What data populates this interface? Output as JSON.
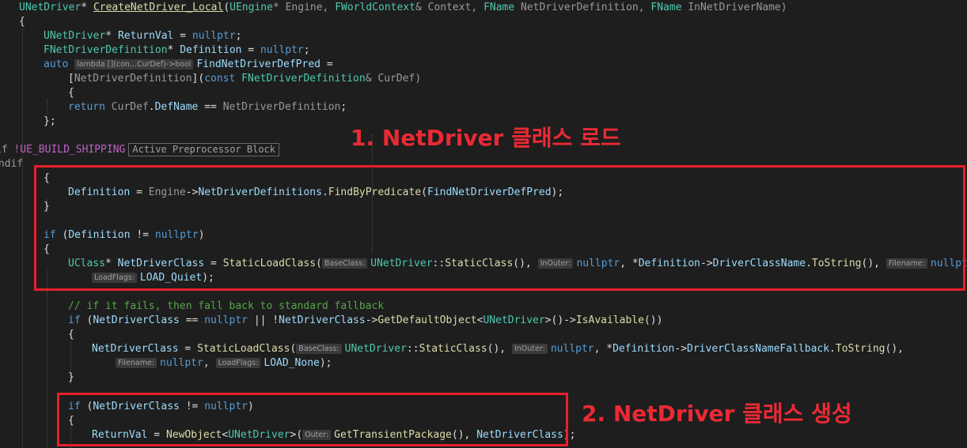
{
  "code": {
    "signature": {
      "ret_type": "UNetDriver",
      "star": "*",
      "name": "CreateNetDriver_Local",
      "open": "(",
      "p1_type": "UEngine",
      "p1_rest": "* Engine, ",
      "p2_type": "FWorldContext",
      "p2_rest": "& Context, ",
      "p3_type": "FName",
      "p3_rest": " NetDriverDefinition, ",
      "p4_type": "FName",
      "p4_rest": " InNetDriverName)"
    },
    "line_open_brace": "{",
    "decl_return": {
      "type": "UNetDriver",
      "star": "* ",
      "var": "ReturnVal",
      "eq": " = ",
      "val": "nullptr",
      "end": ";"
    },
    "decl_definition": {
      "type": "FNetDriverDefinition",
      "star": "* ",
      "var": "Definition",
      "eq": " = ",
      "val": "nullptr",
      "end": ";"
    },
    "lambda_decl": {
      "kw": "auto",
      "hint": "lambda [](con...CurDef)->bool",
      "var": "FindNetDriverDefPred",
      "eq": " ="
    },
    "lambda_capture": {
      "open": "[",
      "capture": "NetDriverDefinition",
      "close": "](",
      "kw": "const",
      "type": "FNetDriverDefinition",
      "rest": "& CurDef)"
    },
    "lambda_open": "{",
    "lambda_return": {
      "kw": "return",
      "obj": "CurDef",
      "dot": ".",
      "member": "DefName",
      "op": " == ",
      "rhs": "NetDriverDefinition",
      "end": ";"
    },
    "lambda_close": "};",
    "preproc_if": {
      "directive": "if",
      "rest": " !UE_BUILD_SHIPPING",
      "box": "Active Preprocessor Block"
    },
    "preproc_endif": {
      "directive": "endif"
    },
    "block1_open": "{",
    "find_def": {
      "lhs": "Definition",
      "op": " = ",
      "obj": "Engine",
      "arrow": "->",
      "member": "NetDriverDefinitions",
      "dot": ".",
      "fn": "FindByPredicate",
      "args_open": "(",
      "arg": "FindNetDriverDefPred",
      "end": ");"
    },
    "block1_close": "}",
    "if_def": {
      "kw": "if",
      "open": " (",
      "var": "Definition",
      "op": " != ",
      "val": "nullptr",
      "close": ")"
    },
    "block2_open": "{",
    "load_class": {
      "type": "UClass",
      "star": "* ",
      "var": "NetDriverClass",
      "eq": " = ",
      "fn": "StaticLoadClass",
      "open": "(",
      "hint1": "BaseClass:",
      "cls": "UNetDriver",
      "scope": "::",
      "static_fn": "StaticClass",
      "call": "(), ",
      "hint2": "InOuter:",
      "null1": "nullptr",
      "sep1": ", *",
      "def": "Definition",
      "arrow": "->",
      "member": "DriverClassName",
      "dot": ".",
      "to_str": "ToString",
      "call2": "(), ",
      "hint3": "Filename:",
      "null2": "nullptr",
      "sep2": ","
    },
    "load_flags": {
      "hint": "LoadFlags:",
      "val": "LOAD_Quiet",
      "end": ");"
    },
    "comment_fallback": "// if it fails, then fall back to standard fallback",
    "if_fallback": {
      "kw": "if",
      "open": " (",
      "var1": "NetDriverClass",
      "op1": " == ",
      "null1": "nullptr",
      "or": " || !",
      "var2": "NetDriverClass",
      "arrow": "->",
      "fn": "GetDefaultObject",
      "lt": "<",
      "type": "UNetDriver",
      "gt": ">()->",
      "fn2": "IsAvailable",
      "close": "())"
    },
    "block3_open": "{",
    "fallback_load": {
      "var": "NetDriverClass",
      "eq": " = ",
      "fn": "StaticLoadClass",
      "open": "(",
      "hint1": "BaseClass:",
      "cls": "UNetDriver",
      "scope": "::",
      "static_fn": "StaticClass",
      "call": "(), ",
      "hint2": "InOuter:",
      "null1": "nullptr",
      "sep1": ", *",
      "def": "Definition",
      "arrow": "->",
      "member": "DriverClassNameFallback",
      "dot": ".",
      "to_str": "ToString",
      "call2": "(),"
    },
    "fallback_args": {
      "hint1": "Filename:",
      "null": "nullptr",
      "sep": ", ",
      "hint2": "LoadFlags:",
      "flag": "LOAD_None",
      "end": ");"
    },
    "block3_close": "}",
    "if_create": {
      "kw": "if",
      "open": " (",
      "var": "NetDriverClass",
      "op": " != ",
      "val": "nullptr",
      "close": ")"
    },
    "block4_open": "{",
    "new_object": {
      "var": "ReturnVal",
      "eq": " = ",
      "fn": "NewObject",
      "lt": "<",
      "type": "UNetDriver",
      "gt": ">(",
      "hint": "Outer:",
      "fn2": "GetTransientPackage",
      "call": "(), ",
      "arg": "NetDriverClass",
      "end": ");"
    }
  },
  "annotations": {
    "label1": "1. NetDriver 클래스 로드",
    "label2": "2. NetDriver 클래스 생성",
    "color": "#e8202a"
  },
  "colors": {
    "background": "#1e1e1e",
    "keyword": "#569cd6",
    "type": "#4ec9b0",
    "function": "#dcdcaa",
    "variable": "#9cdcfe",
    "comment": "#57a64a"
  }
}
